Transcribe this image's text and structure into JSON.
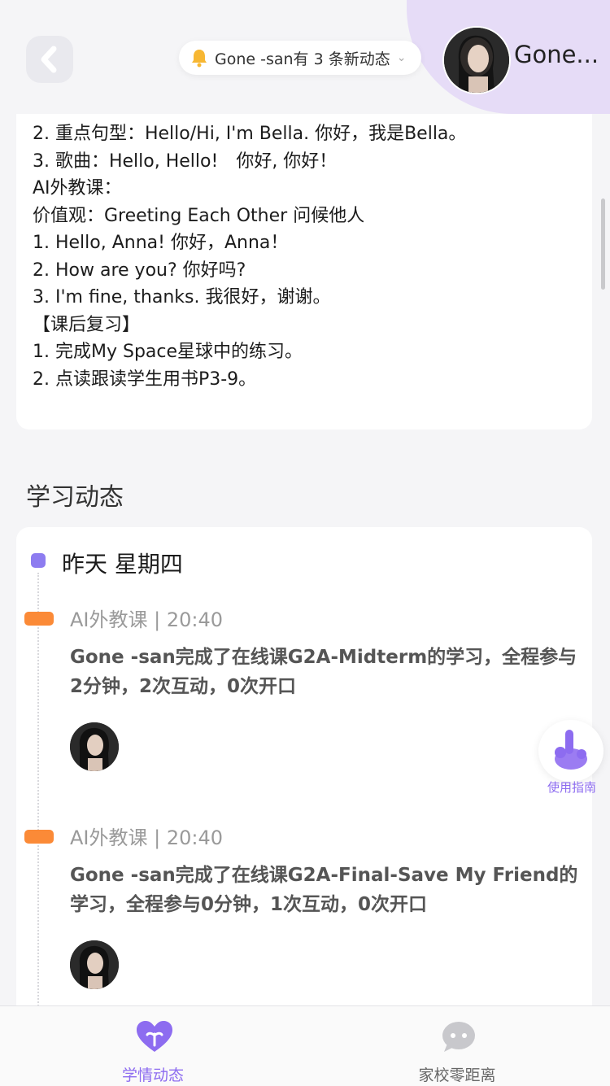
{
  "header": {
    "notice_text": "Gone -san有 3 条新动态",
    "user_name": "Gone..."
  },
  "notes": {
    "lines": [
      "2. 重点句型：Hello/Hi, I'm Bella. 你好，我是Bella。",
      "3. 歌曲：Hello, Hello!　你好, 你好！",
      "AI外教课：",
      "价值观：Greeting Each Other 问候他人",
      "1. Hello, Anna! 你好，Anna！",
      "2. How are you? 你好吗?",
      "3. I'm fine, thanks. 我很好，谢谢。",
      "【课后复习】",
      "1. 完成My Space星球中的练习。",
      "2. 点读跟读学生用书P3-9。"
    ]
  },
  "section_title": "学习动态",
  "timeline": {
    "day_label": "昨天 星期四",
    "entries": [
      {
        "meta": "AI外教课 | 20:40",
        "desc": "Gone -san完成了在线课G2A-Midterm的学习，全程参与2分钟，2次互动，0次开口"
      },
      {
        "meta": "AI外教课 | 20:40",
        "desc": "Gone -san完成了在线课G2A-Final-Save My Friend的学习，全程参与0分钟，1次互动，0次开口"
      }
    ]
  },
  "guide": {
    "label": "使用指南"
  },
  "tabs": [
    {
      "label": "学情动态",
      "icon": "heart-sprout-icon",
      "active": true
    },
    {
      "label": "家校零距离",
      "icon": "chat-bubble-icon",
      "active": false
    }
  ],
  "colors": {
    "accent_purple": "#8d6cf0",
    "timeline_dot": "#8d7cf0",
    "tag_orange": "#fb8a37",
    "blob": "#e6dcf7"
  }
}
